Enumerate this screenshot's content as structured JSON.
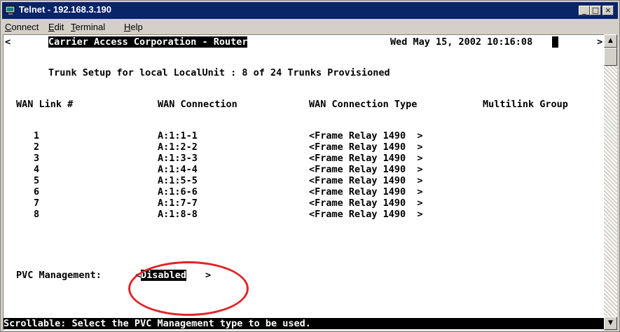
{
  "window": {
    "title": "Telnet - 192.168.3.190",
    "minimize_glyph": "_",
    "maximize_glyph": "□",
    "close_glyph": "×"
  },
  "menu": [
    "Connect",
    "Edit",
    "Terminal",
    "Help"
  ],
  "terminal": {
    "left_arrow": "<",
    "right_arrow": ">",
    "company": "Carrier Access Corporation - Router",
    "datetime": "Wed May 15, 2002 10:16:08",
    "subtitle": "Trunk Setup for local LocalUnit : 8 of 24 Trunks Provisioned",
    "columns": [
      "WAN Link #",
      "WAN Connection",
      "WAN Connection Type",
      "Multilink Group"
    ],
    "rows": [
      {
        "link": "1",
        "connection": "A:1:1-1",
        "type": "<Frame Relay 1490  >"
      },
      {
        "link": "2",
        "connection": "A:1:2-2",
        "type": "<Frame Relay 1490  >"
      },
      {
        "link": "3",
        "connection": "A:1:3-3",
        "type": "<Frame Relay 1490  >"
      },
      {
        "link": "4",
        "connection": "A:1:4-4",
        "type": "<Frame Relay 1490  >"
      },
      {
        "link": "5",
        "connection": "A:1:5-5",
        "type": "<Frame Relay 1490  >"
      },
      {
        "link": "6",
        "connection": "A:1:6-6",
        "type": "<Frame Relay 1490  >"
      },
      {
        "link": "7",
        "connection": "A:1:7-7",
        "type": "<Frame Relay 1490  >"
      },
      {
        "link": "8",
        "connection": "A:1:8-8",
        "type": "<Frame Relay 1490  >"
      }
    ],
    "pvc_label": "PVC Management:",
    "pvc_open": "<",
    "pvc_value": "Disabled",
    "pvc_close": ">",
    "status": "Scrollable: Select the PVC Management type to be used."
  },
  "colors": {
    "titlebar": "#0a246a",
    "annotation": "#e0242a"
  },
  "icons": {
    "app": "telnet-monitor-icon",
    "scroll_up": "triangle-up",
    "scroll_down": "triangle-down"
  }
}
